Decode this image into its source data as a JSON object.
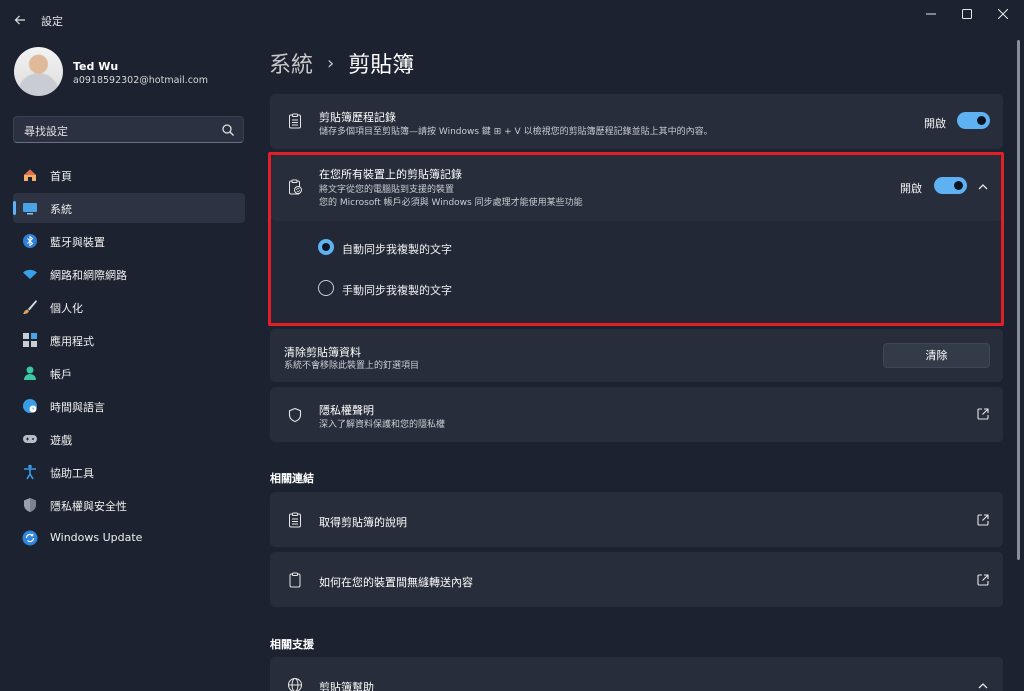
{
  "window": {
    "app_title": "設定",
    "controls": [
      "minimize-icon",
      "maximize-icon",
      "close-icon"
    ]
  },
  "user": {
    "name": "Ted Wu",
    "email": "a0918592302@hotmail.com"
  },
  "search": {
    "placeholder": "尋找設定"
  },
  "sidebar": {
    "items": [
      {
        "label": "首頁",
        "icon": "home-icon",
        "active": false
      },
      {
        "label": "系統",
        "icon": "system-icon",
        "active": true
      },
      {
        "label": "藍牙與裝置",
        "icon": "bluetooth-icon",
        "active": false
      },
      {
        "label": "網路和網際網路",
        "icon": "wifi-icon",
        "active": false
      },
      {
        "label": "個人化",
        "icon": "brush-icon",
        "active": false
      },
      {
        "label": "應用程式",
        "icon": "apps-icon",
        "active": false
      },
      {
        "label": "帳戶",
        "icon": "account-icon",
        "active": false
      },
      {
        "label": "時間與語言",
        "icon": "globe-clock-icon",
        "active": false
      },
      {
        "label": "遊戲",
        "icon": "gamepad-icon",
        "active": false
      },
      {
        "label": "協助工具",
        "icon": "accessibility-icon",
        "active": false
      },
      {
        "label": "隱私權與安全性",
        "icon": "shield-icon",
        "active": false
      },
      {
        "label": "Windows Update",
        "icon": "update-icon",
        "active": false
      }
    ]
  },
  "breadcrumb": {
    "parent": "系統",
    "separator": "›",
    "current": "剪貼簿"
  },
  "history": {
    "title": "剪貼簿歷程記錄",
    "subtitle": "儲存多個項目至剪貼簿—請按 Windows 鍵 ⊞ + V 以檢視您的剪貼簿歷程記錄並貼上其中的內容。",
    "toggle_label": "開啟",
    "enabled": true
  },
  "sync": {
    "title": "在您所有裝置上的剪貼簿記錄",
    "subtitle_1": "將文字從您的電腦貼到支援的裝置",
    "subtitle_2": "您的 Microsoft 帳戶必須與 Windows 同步處理才能使用某些功能",
    "toggle_label": "開啟",
    "enabled": true,
    "options": [
      {
        "label": "自動同步我複製的文字",
        "selected": true
      },
      {
        "label": "手動同步我複製的文字",
        "selected": false
      }
    ]
  },
  "clear": {
    "title": "清除剪貼簿資料",
    "subtitle": "系統不會移除此裝置上的釘選項目",
    "button_label": "清除"
  },
  "privacy": {
    "title": "隱私權聲明",
    "subtitle": "深入了解資料保護和您的隱私權"
  },
  "related_links": {
    "heading": "相關連結",
    "items": [
      {
        "label": "取得剪貼簿的說明"
      },
      {
        "label": "如何在您的裝置間無縫轉送內容"
      }
    ]
  },
  "related_support": {
    "heading": "相關支援",
    "items": [
      {
        "label": "剪貼簿幫助"
      }
    ]
  },
  "colors": {
    "accent": "#5fb2f2",
    "highlight_border": "#e21f26",
    "background": "#1c2230",
    "card": "#272d3a"
  }
}
